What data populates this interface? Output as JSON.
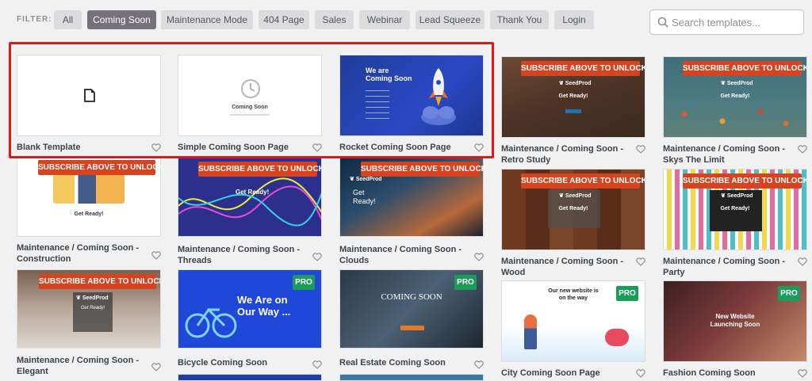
{
  "filter": {
    "label": "FILTER:",
    "pills": [
      "All",
      "Coming Soon",
      "Maintenance Mode",
      "404 Page",
      "Sales",
      "Webinar",
      "Lead Squeeze",
      "Thank You",
      "Login"
    ],
    "active": "Coming Soon"
  },
  "search": {
    "placeholder": "Search templates..."
  },
  "badges": {
    "subscribe": "SUBSCRIBE ABOVE TO UNLOCK",
    "pro": "PRO"
  },
  "brand": {
    "seedprod": "SeedProd"
  },
  "templates": {
    "blank": {
      "title": "Blank Template"
    },
    "simple": {
      "title": "Simple Coming Soon Page",
      "thumb_text": "Coming Soon"
    },
    "rocket": {
      "title": "Rocket Coming Soon Page",
      "thumb_heading_1": "We are",
      "thumb_heading_2": "Coming Soon"
    },
    "retro": {
      "title": "Maintenance / Coming Soon - Retro Study",
      "thumb_text": "Get Ready!"
    },
    "skys": {
      "title": "Maintenance / Coming Soon - Skys The Limit",
      "thumb_text": "Get Ready!"
    },
    "construction": {
      "title": "Maintenance / Coming Soon - Construction",
      "thumb_text": "Get Ready!"
    },
    "threads": {
      "title": "Maintenance / Coming Soon - Threads",
      "thumb_text": "Get Ready!"
    },
    "clouds": {
      "title": "Maintenance / Coming Soon - Clouds",
      "thumb_text_1": "Get",
      "thumb_text_2": "Ready!"
    },
    "wood": {
      "title": "Maintenance / Coming Soon - Wood",
      "thumb_text": "Get Ready!"
    },
    "party": {
      "title": "Maintenance / Coming Soon - Party",
      "thumb_text": "Get Ready!"
    },
    "elegant": {
      "title": "Maintenance / Coming Soon - Elegant",
      "thumb_text": "Get Ready!"
    },
    "bicycle": {
      "title": "Bicycle Coming Soon",
      "thumb_heading_1": "We Are on",
      "thumb_heading_2": "Our Way ..."
    },
    "realestate": {
      "title": "Real Estate Coming Soon",
      "thumb_text": "COMING SOON"
    },
    "city": {
      "title": "City Coming Soon Page",
      "thumb_text_1": "Our new website is",
      "thumb_text_2": "on the way"
    },
    "fashion": {
      "title": "Fashion Coming Soon",
      "thumb_text_1": "New Website",
      "thumb_text_2": "Launching Soon"
    }
  },
  "colors": {
    "accent_active": "#76707a",
    "subscribe_badge": "#d6431e",
    "pro_badge": "#1a9c5b",
    "highlight_box": "#e5161a"
  },
  "icons": [
    "search-icon",
    "file-icon",
    "clock-icon",
    "heart-icon",
    "rocket-icon",
    "seedprod-leaf-icon"
  ]
}
